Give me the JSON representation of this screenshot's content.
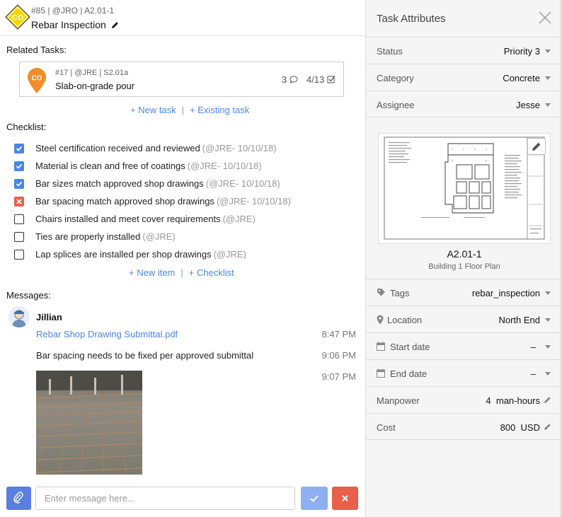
{
  "header": {
    "badge": "CO",
    "meta": "#85 | @JRO | A2.01-1",
    "title": "Rebar Inspection"
  },
  "related": {
    "label": "Related Tasks:",
    "task": {
      "badge": "CO",
      "meta": "#17 | @JRE | S2.01a",
      "title": "Slab-on-grade pour",
      "comments": "3",
      "checks": "4/13"
    },
    "new_task": "+ New task",
    "existing_task": "+ Existing task",
    "separator": "|"
  },
  "checklist": {
    "label": "Checklist:",
    "items": [
      {
        "text": "Steel certification received and reviewed",
        "meta": "(@JRE- 10/10/18)",
        "state": "checked"
      },
      {
        "text": "Material is clean and free of coatings",
        "meta": "(@JRE- 10/10/18)",
        "state": "checked"
      },
      {
        "text": "Bar sizes match approved shop drawings",
        "meta": "(@JRE- 10/10/18)",
        "state": "checked"
      },
      {
        "text": "Bar spacing match approved shop drawings",
        "meta": "(@JRE- 10/10/18)",
        "state": "failed"
      },
      {
        "text": "Chairs installed and meet cover requirements",
        "meta": "(@JRE)",
        "state": "empty"
      },
      {
        "text": "Ties are properly installed",
        "meta": "(@JRE)",
        "state": "empty"
      },
      {
        "text": "Lap splices are installed per shop drawings",
        "meta": "(@JRE)",
        "state": "empty"
      }
    ],
    "new_item": "+ New item",
    "add_checklist": "+ Checklist",
    "separator": "|"
  },
  "messages": {
    "label": "Messages:",
    "author": "Jillian",
    "attachment": "Rebar Shop Drawing Submittal.pdf",
    "attachment_time": "8:47 PM",
    "text": "Bar spacing needs to be fixed per approved submittal",
    "text_time": "9:06 PM",
    "photo_time": "9:07 PM",
    "input_placeholder": "Enter message here..."
  },
  "attributes": {
    "title": "Task Attributes",
    "status": {
      "label": "Status",
      "value": "Priority 3"
    },
    "category": {
      "label": "Category",
      "value": "Concrete"
    },
    "assignee": {
      "label": "Assignee",
      "value": "Jesse"
    },
    "plan": {
      "name": "A2.01-1",
      "desc": "Building 1 Floor Plan"
    },
    "tags": {
      "label": "Tags",
      "value": "rebar_inspection"
    },
    "location": {
      "label": "Location",
      "value": "North End"
    },
    "start_date": {
      "label": "Start date",
      "value": "–"
    },
    "end_date": {
      "label": "End date",
      "value": "–"
    },
    "manpower": {
      "label": "Manpower",
      "value": "4  man-hours"
    },
    "cost": {
      "label": "Cost",
      "value": "800  USD"
    }
  },
  "colors": {
    "accent": "#4a86e8",
    "co_badge": "#f5d400",
    "co_pin": "#f28c28",
    "danger": "#e8604c",
    "attach_button": "#5a7fe0",
    "send_button": "#8fb0f0"
  }
}
